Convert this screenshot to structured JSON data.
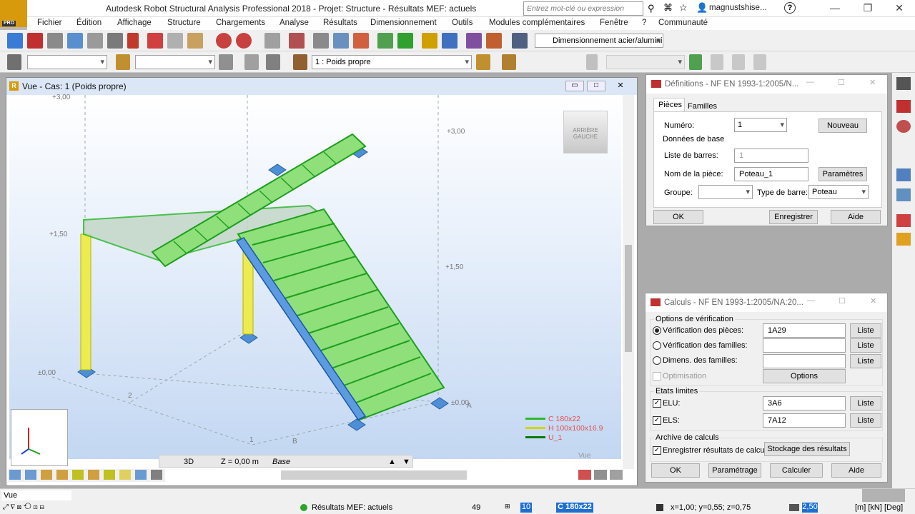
{
  "app": {
    "title": "Autodesk Robot Structural Analysis Professional 2018 - Projet: Structure - Résultats MEF: actuels",
    "logo": "R",
    "logo_sub": "PRO",
    "search_placeholder": "Entrez mot-clé ou expression",
    "user": "magnustshise...",
    "help": "?"
  },
  "menu": [
    "Fichier",
    "Édition",
    "Affichage",
    "Structure",
    "Chargements",
    "Analyse",
    "Résultats",
    "Dimensionnement",
    "Outils",
    "Modules complémentaires",
    "Fenêtre",
    "?",
    "Communauté"
  ],
  "toolbar": {
    "module_combo": "Dimensionnement acier/alumini",
    "load_case": "1 : Poids propre"
  },
  "view": {
    "title": "Vue - Cas: 1 (Poids propre)",
    "mode": "3D",
    "zlevel": "Z = 0,00 m",
    "zbase": "Base",
    "vue_label": "Vue",
    "cube_label1": "ARRIÈRE",
    "cube_label2": "GAUCHE",
    "levels": [
      "+3,00",
      "+3,00",
      "+1,50",
      "+1,50",
      "±0,00",
      "±0,00"
    ],
    "grid": [
      "2",
      "1",
      "B",
      "A"
    ],
    "legend": [
      {
        "label": "C 180x22",
        "color": "#2eb82e"
      },
      {
        "label": "H 100x100x16.9",
        "color": "#d4d400"
      },
      {
        "label": "U_1",
        "color": "#0a7a0a"
      }
    ]
  },
  "def_dialog": {
    "title": "Définitions - NF EN 1993-1:2005/N...",
    "tabs": [
      "Pièces",
      "Familles"
    ],
    "numero_label": "Numéro:",
    "numero_value": "1",
    "nouveau": "Nouveau",
    "donnees": "Données de base",
    "liste_label": "Liste de barres:",
    "liste_value": "1",
    "nom_label": "Nom de la pièce:",
    "nom_value": "Poteau_1",
    "parametres": "Paramètres",
    "groupe_label": "Groupe:",
    "type_label": "Type de barre:",
    "type_value": "Poteau",
    "ok": "OK",
    "enregistrer": "Enregistrer",
    "aide": "Aide"
  },
  "calc_dialog": {
    "title": "Calculs - NF EN 1993-1:2005/NA:20...",
    "options": "Options de vérification",
    "verif_pieces": "Vérification des pièces:",
    "verif_pieces_value": "1A29",
    "verif_familles": "Vérification des familles:",
    "dimens": "Dimens. des familles:",
    "liste": "Liste",
    "optimisation": "Optimisation",
    "options_btn": "Options",
    "etats": "Etats limites",
    "elu": "ELU:",
    "elu_value": "3A6",
    "els": "ELS:",
    "els_value": "7A12",
    "archive": "Archive de calculs",
    "enregistrer_res": "Enregistrer résultats de calculs",
    "stockage": "Stockage des résultats",
    "ok": "OK",
    "parametrage": "Paramétrage",
    "calculer": "Calculer",
    "aide": "Aide"
  },
  "status": {
    "vue": "Vue",
    "results": "Résultats MEF: actuels",
    "num": "49",
    "num2": "10",
    "section": "C 180x22",
    "coords": "x=1,00; y=0,55; z=0,75",
    "val": "2,50",
    "units": "[m] [kN] [Deg]"
  }
}
